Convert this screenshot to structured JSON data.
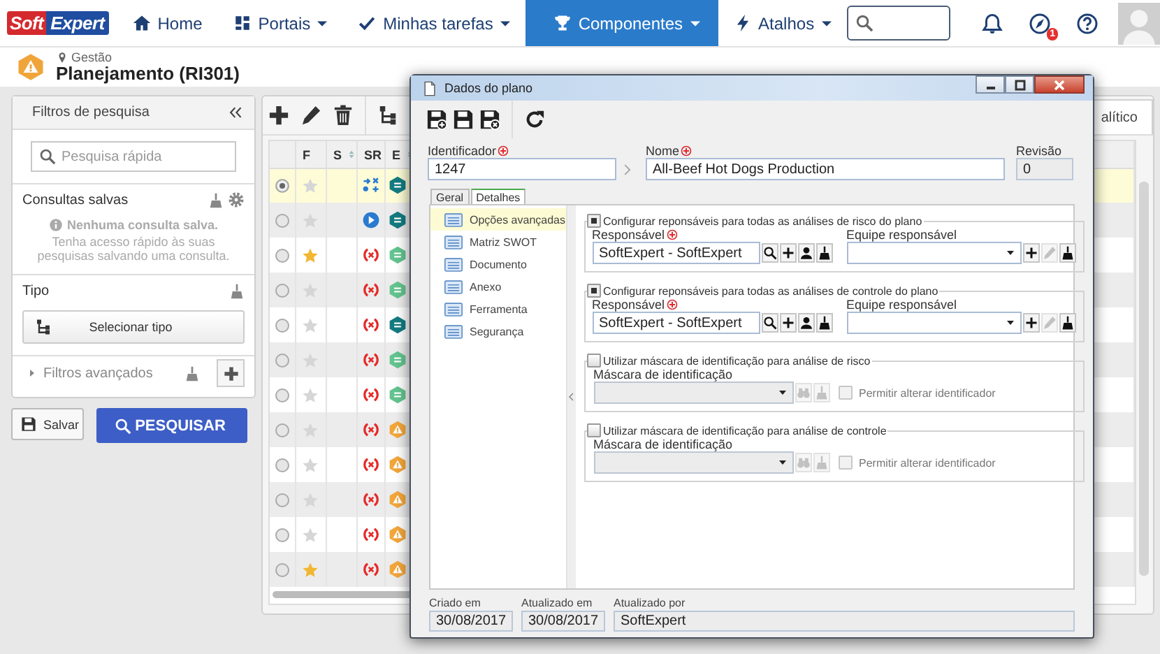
{
  "nav": {
    "logo": {
      "first": "Soft",
      "second": "Expert"
    },
    "items": [
      {
        "label": "Home",
        "dropdown": false,
        "selected": false
      },
      {
        "label": "Portais",
        "dropdown": true,
        "selected": false
      },
      {
        "label": "Minhas tarefas",
        "dropdown": true,
        "selected": false
      },
      {
        "label": "Componentes",
        "dropdown": true,
        "selected": true
      },
      {
        "label": "Atalhos",
        "dropdown": true,
        "selected": false
      }
    ],
    "badge": "1"
  },
  "header": {
    "module": "Gestão",
    "title": "Planejamento (RI301)"
  },
  "filters": {
    "title": "Filtros de pesquisa",
    "search_placeholder": "Pesquisa rápida",
    "saved": {
      "title": "Consultas salvas",
      "empty_title": "Nenhuma consulta salva.",
      "empty_text": "Tenha acesso rápido às suas pesquisas salvando uma consulta."
    },
    "type": {
      "title": "Tipo",
      "button": "Selecionar tipo"
    },
    "advanced": {
      "label": "Filtros avançados",
      "expanded": false
    }
  },
  "actions": {
    "save": "Salvar",
    "search": "PESQUISAR"
  },
  "tab_fragment": "alítico",
  "table": {
    "columns": [
      {
        "label": "F",
        "sortable": false
      },
      {
        "label": "S",
        "sortable": true
      },
      {
        "label": "SR",
        "sortable": false
      },
      {
        "label": "E",
        "sortable": true
      }
    ],
    "rows": [
      {
        "selected": true,
        "favorite": false,
        "sr": {
          "kind": "workflow"
        },
        "e": {
          "kind": "hex-dark"
        }
      },
      {
        "selected": false,
        "favorite": false,
        "sr": {
          "kind": "play"
        },
        "e": {
          "kind": "hex-dark"
        }
      },
      {
        "selected": false,
        "favorite": true,
        "sr": {
          "kind": "error"
        },
        "e": {
          "kind": "hex-light"
        }
      },
      {
        "selected": false,
        "favorite": false,
        "sr": {
          "kind": "error"
        },
        "e": {
          "kind": "hex-light"
        }
      },
      {
        "selected": false,
        "favorite": false,
        "sr": {
          "kind": "error"
        },
        "e": {
          "kind": "hex-dark"
        }
      },
      {
        "selected": false,
        "favorite": false,
        "sr": {
          "kind": "error"
        },
        "e": {
          "kind": "hex-light"
        }
      },
      {
        "selected": false,
        "favorite": false,
        "sr": {
          "kind": "error"
        },
        "e": {
          "kind": "hex-light"
        }
      },
      {
        "selected": false,
        "favorite": false,
        "sr": {
          "kind": "error"
        },
        "e": {
          "kind": "warning"
        }
      },
      {
        "selected": false,
        "favorite": false,
        "sr": {
          "kind": "error"
        },
        "e": {
          "kind": "warning"
        }
      },
      {
        "selected": false,
        "favorite": false,
        "sr": {
          "kind": "error"
        },
        "e": {
          "kind": "warning"
        }
      },
      {
        "selected": false,
        "favorite": false,
        "sr": {
          "kind": "error"
        },
        "e": {
          "kind": "warning"
        }
      },
      {
        "selected": false,
        "favorite": true,
        "sr": {
          "kind": "error"
        },
        "e": {
          "kind": "warning"
        }
      }
    ]
  },
  "dialog": {
    "title": "Dados do plano",
    "identifier": {
      "label": "Identificador",
      "required": true,
      "value": "1247"
    },
    "name": {
      "label": "Nome",
      "required": true,
      "value": "All-Beef Hot Dogs Production"
    },
    "revision": {
      "label": "Revisão",
      "value": "0"
    },
    "tabs": [
      {
        "label": "Geral",
        "selected": false
      },
      {
        "label": "Detalhes",
        "selected": true
      }
    ],
    "nav_items": [
      {
        "label": "Opções avançadas",
        "selected": true
      },
      {
        "label": "Matriz SWOT",
        "selected": false
      },
      {
        "label": "Documento",
        "selected": false
      },
      {
        "label": "Anexo",
        "selected": false
      },
      {
        "label": "Ferramenta",
        "selected": false
      },
      {
        "label": "Segurança",
        "selected": false
      }
    ],
    "groups": [
      {
        "kind": "responsibles",
        "label": "Configurar reponsáveis para todas as análises de risco do plano",
        "checked": true,
        "fields": [
          {
            "kind": "text",
            "label": "Responsável",
            "required": true,
            "value": "SoftExpert - SoftExpert",
            "disabled": false,
            "buttons": [
              {
                "kind": "search",
                "disabled": false
              },
              {
                "kind": "add",
                "disabled": false
              },
              {
                "kind": "user",
                "disabled": false
              },
              {
                "kind": "clear",
                "disabled": false
              }
            ]
          },
          {
            "kind": "select",
            "label": "Equipe responsável",
            "required": false,
            "disabled": false,
            "buttons": [
              {
                "kind": "add",
                "disabled": false
              },
              {
                "kind": "edit",
                "disabled": true
              },
              {
                "kind": "clear",
                "disabled": false
              }
            ]
          }
        ]
      },
      {
        "kind": "responsibles",
        "label": "Configurar reponsáveis para todas as análises de controle do plano",
        "checked": true,
        "fields": [
          {
            "kind": "text",
            "label": "Responsável",
            "required": true,
            "value": "SoftExpert - SoftExpert",
            "disabled": false,
            "buttons": [
              {
                "kind": "search",
                "disabled": false
              },
              {
                "kind": "add",
                "disabled": false
              },
              {
                "kind": "user",
                "disabled": false
              },
              {
                "kind": "clear",
                "disabled": false
              }
            ]
          },
          {
            "kind": "select",
            "label": "Equipe responsável",
            "required": false,
            "disabled": false,
            "buttons": [
              {
                "kind": "add",
                "disabled": false
              },
              {
                "kind": "edit",
                "disabled": true
              },
              {
                "kind": "clear",
                "disabled": false
              }
            ]
          }
        ]
      },
      {
        "kind": "mask",
        "label": "Utilizar máscara de identificação para análise de risco",
        "checked": false,
        "fields": [
          {
            "kind": "select",
            "label": "Máscara de identificação",
            "required": false,
            "disabled": true,
            "buttons": [
              {
                "kind": "binoculars",
                "disabled": true
              },
              {
                "kind": "clear",
                "disabled": true
              }
            ]
          }
        ],
        "option": {
          "label": "Permitir alterar identificador",
          "checked": false,
          "disabled": true
        }
      },
      {
        "kind": "mask",
        "label": "Utilizar máscara de identificação para análise de controle",
        "checked": false,
        "fields": [
          {
            "kind": "select",
            "label": "Máscara de identificação",
            "required": false,
            "disabled": true,
            "buttons": [
              {
                "kind": "binoculars",
                "disabled": true
              },
              {
                "kind": "clear",
                "disabled": true
              }
            ]
          }
        ],
        "option": {
          "label": "Permitir alterar identificador",
          "checked": false,
          "disabled": true
        }
      }
    ],
    "footer": [
      {
        "label": "Criado em",
        "value": "30/08/2017"
      },
      {
        "label": "Atualizado em",
        "value": "30/08/2017"
      },
      {
        "label": "Atualizado por",
        "value": "SoftExpert"
      }
    ]
  }
}
